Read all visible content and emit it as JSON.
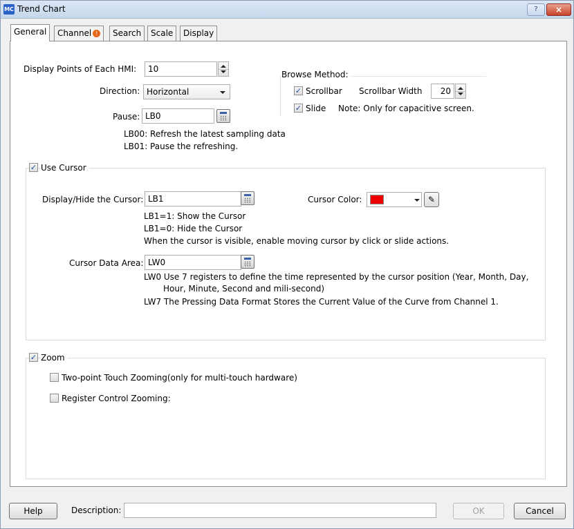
{
  "window": {
    "app_icon": "MC",
    "title": "Trend Chart",
    "help_glyph": "?",
    "close_glyph": "×"
  },
  "tabs": [
    {
      "label": "General"
    },
    {
      "label": "Channel"
    },
    {
      "label": "Search"
    },
    {
      "label": "Scale"
    },
    {
      "label": "Display"
    }
  ],
  "channel_warn_glyph": "!",
  "general": {
    "display_points_label": "Display Points of Each HMI:",
    "display_points_value": "10",
    "direction_label": "Direction:",
    "direction_value": "Horizontal",
    "pause_label": "Pause:",
    "pause_value": "LB0",
    "pause_note_1": "LB00: Refresh the latest sampling data",
    "pause_note_2": "LB01: Pause the refreshing."
  },
  "browse": {
    "title": "Browse Method:",
    "scrollbar_label": "Scrollbar",
    "scrollbar_checked": true,
    "scrollbar_width_label": "Scrollbar Width",
    "scrollbar_width_value": "20",
    "slide_label": "Slide",
    "slide_checked": true,
    "slide_note": "Note: Only for capacitive screen."
  },
  "cursor": {
    "use_label": "Use Cursor",
    "use_checked": true,
    "display_hide_label": "Display/Hide the Cursor:",
    "display_hide_value": "LB1",
    "color_label": "Cursor Color:",
    "color_value": "#ee0000",
    "note_show": "LB1=1: Show the Cursor",
    "note_hide": "LB1=0: Hide the Cursor",
    "note_visible": "When the cursor is visible, enable moving cursor by click or slide actions.",
    "data_area_label": "Cursor Data Area:",
    "data_area_value": "LW0",
    "data_note_1": "LW0 Use 7 registers to define the time represented by the cursor position (Year, Month, Day,",
    "data_note_2": "Hour, Minute, Second and mili-second)",
    "data_note_3": "LW7 The Pressing Data Format Stores the Current Value of the Curve from Channel 1."
  },
  "zoom": {
    "label": "Zoom",
    "checked": true,
    "two_point_label": "Two-point Touch Zooming(only for multi-touch hardware)",
    "two_point_checked": false,
    "register_label": "Register Control Zooming:",
    "register_checked": false
  },
  "footer": {
    "help_label": "Help",
    "description_label": "Description:",
    "description_value": "",
    "ok_label": "OK",
    "cancel_label": "Cancel"
  },
  "icons": {
    "check_glyph": "✓",
    "eyedropper_glyph": "✎"
  }
}
